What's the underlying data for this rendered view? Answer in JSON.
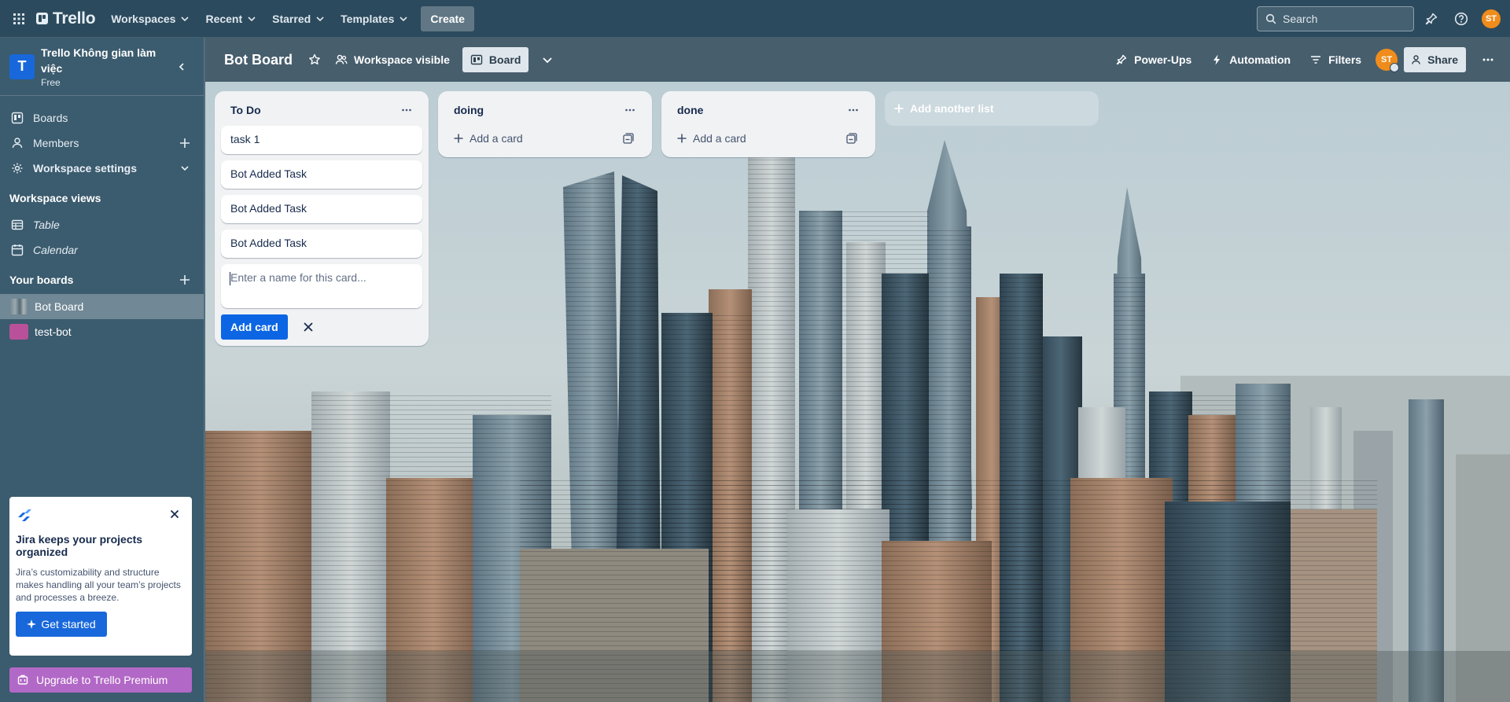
{
  "topbar": {
    "logo_text": "Trello",
    "nav": [
      {
        "label": "Workspaces"
      },
      {
        "label": "Recent"
      },
      {
        "label": "Starred"
      },
      {
        "label": "Templates"
      }
    ],
    "create_label": "Create",
    "search_placeholder": "Search",
    "avatar_initials": "ST"
  },
  "sidebar": {
    "workspace_initial": "T",
    "workspace_name": "Trello Không gian làm việc",
    "workspace_plan": "Free",
    "items": [
      {
        "label": "Boards",
        "icon": "trello-board-icon"
      },
      {
        "label": "Members",
        "icon": "person-icon"
      },
      {
        "label": "Workspace settings",
        "icon": "gear-icon"
      }
    ],
    "views_heading": "Workspace views",
    "views": [
      {
        "label": "Table",
        "icon": "table-icon"
      },
      {
        "label": "Calendar",
        "icon": "calendar-icon"
      }
    ],
    "boards_heading": "Your boards",
    "boards": [
      {
        "label": "Bot Board",
        "active": true
      },
      {
        "label": "test-bot",
        "active": false
      }
    ],
    "promo": {
      "title": "Jira keeps your projects organized",
      "text": "Jira’s customizability and structure makes handling all your team’s projects and processes a breeze.",
      "button": "Get started"
    },
    "upgrade_label": "Upgrade to Trello Premium"
  },
  "board": {
    "title": "Bot Board",
    "visibility_label": "Workspace visible",
    "view_label": "Board",
    "powerups_label": "Power-Ups",
    "automation_label": "Automation",
    "filters_label": "Filters",
    "avatar_initials": "ST",
    "share_label": "Share",
    "lists": [
      {
        "title": "To Do",
        "cards": [
          "task 1",
          "Bot Added Task",
          "Bot Added Task",
          "Bot Added Task"
        ],
        "composer_placeholder": "Enter a name for this card...",
        "add_card_button": "Add card"
      },
      {
        "title": "doing",
        "add_label": "Add a card"
      },
      {
        "title": "done",
        "add_label": "Add a card"
      }
    ],
    "add_list_label": "Add another list"
  },
  "colors": {
    "topbar_bg": "#2c4a5d",
    "sidebar_bg": "#3b5b6e",
    "primary_button": "#0c66e4",
    "avatar": "#f08c1b",
    "premium": "#b268c6"
  }
}
